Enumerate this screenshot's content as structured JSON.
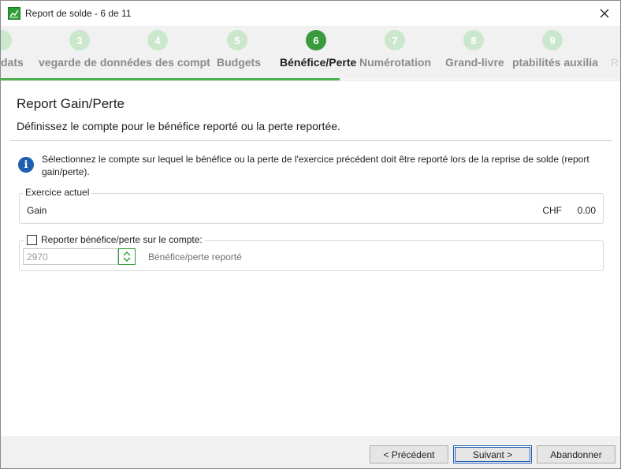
{
  "window": {
    "title": "Report de solde - 6 de 11"
  },
  "steps": [
    {
      "number": "",
      "label": "dats"
    },
    {
      "number": "3",
      "label": "vegarde de donnédes des compt"
    },
    {
      "number": "4",
      "label": ""
    },
    {
      "number": "5",
      "label": "Budgets"
    },
    {
      "number": "6",
      "label": "Bénéfice/Perte"
    },
    {
      "number": "7",
      "label": "Numérotation"
    },
    {
      "number": "8",
      "label": "Grand-livre"
    },
    {
      "number": "9",
      "label": "ptabilités auxilia"
    },
    {
      "number": "",
      "label": "R"
    }
  ],
  "content": {
    "title": "Report Gain/Perte",
    "subtitle": "Définissez le compte pour le bénéfice reporté ou la perte reportée.",
    "info": "Sélectionnez le compte sur lequel le bénéfice ou la perte de l'exercice précédent doit être reporté lors de la reprise de solde (report gain/perte).",
    "current_year": {
      "legend": "Exercice actuel",
      "label": "Gain",
      "currency": "CHF",
      "amount": "0.00"
    },
    "carry": {
      "checkbox_label": "Reporter bénéfice/perte sur le compte:",
      "checked": false,
      "account_value": "2970",
      "account_description": "Bénéfice/perte reporté"
    }
  },
  "buttons": {
    "previous": "< Précédent",
    "next": "Suivant >",
    "cancel": "Abandonner"
  },
  "colors": {
    "active_step": "#3a9a3e",
    "inactive_step": "#cce8cc",
    "underline": "#4caf50",
    "info_icon": "#1f5fb0"
  }
}
